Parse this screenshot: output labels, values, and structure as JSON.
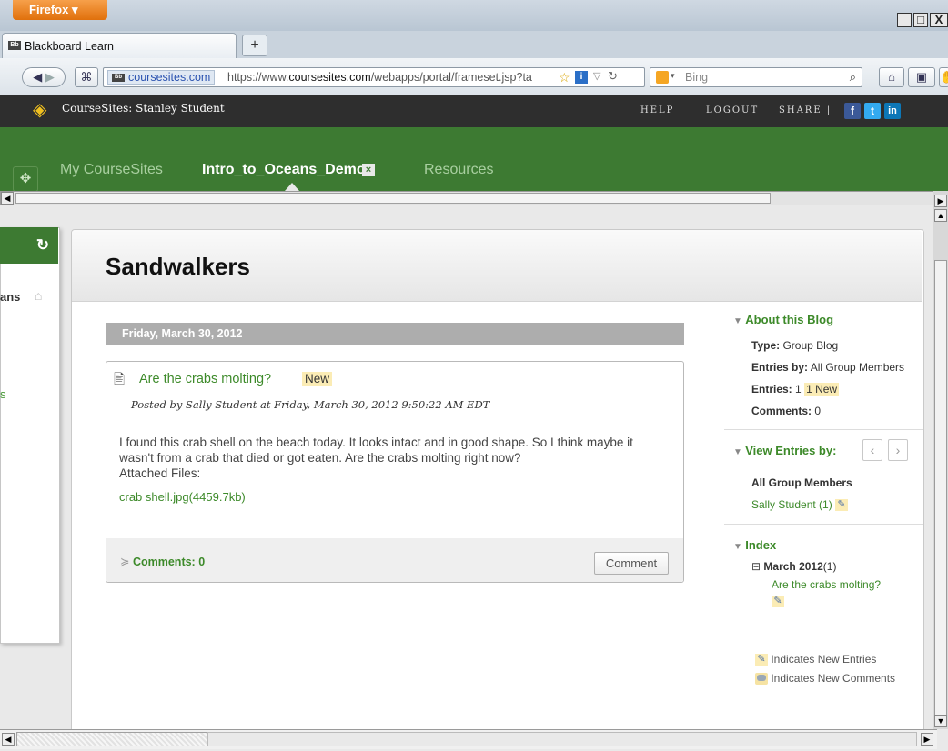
{
  "browser": {
    "menu_label": "Firefox",
    "tab_title": "Blackboard Learn",
    "new_tab": "+",
    "site_badge": "coursesites.com",
    "url_prefix": "https://www.",
    "url_domain": "coursesites.com",
    "url_path": "/webapps/portal/frameset.jsp?ta",
    "search_placeholder": "Bing",
    "win_min": "_",
    "win_max": "□",
    "win_close": "X"
  },
  "coursesites": {
    "title": "CourseSites: Stanley Student",
    "help": "HELP",
    "logout": "LOGOUT",
    "share": "SHARE |",
    "social": [
      "f",
      "t",
      "in"
    ]
  },
  "nav": {
    "my_coursesites": "My CourseSites",
    "current_course": "Intro_to_Oceans_Demo",
    "resources": "Resources",
    "close_tab": "×"
  },
  "left_panel": {
    "partial_title": "ans",
    "partial_link": "s",
    "refresh": "↻"
  },
  "blog": {
    "title": "Sandwalkers",
    "date_heading": "Friday, March 30, 2012",
    "entry": {
      "title": "Are the crabs molting?",
      "badge": "New",
      "posted": "Posted by Sally Student at Friday, March 30, 2012 9:50:22 AM EDT",
      "body": "I found this crab shell on the beach today. It looks intact and in good shape. So I think maybe it wasn't from a crab that died or got eaten. Are the crabs molting right now?",
      "attached_label": "Attached Files:",
      "attachment": "crab shell.jpg(4459.7kb)",
      "comments_toggle": "Comments: 0",
      "comment_button": "Comment"
    }
  },
  "sidebar": {
    "about": {
      "heading": "About this Blog",
      "type_label": "Type:",
      "type_value": "Group Blog",
      "entries_by_label": "Entries by:",
      "entries_by_value": "All Group Members",
      "entries_label": "Entries:",
      "entries_value": "1",
      "entries_new": "1 New",
      "comments_label": "Comments:",
      "comments_value": "0"
    },
    "view": {
      "heading": "View Entries by:",
      "prev": "‹",
      "next": "›",
      "all": "All Group Members",
      "member": "Sally Student (1)"
    },
    "index": {
      "heading": "Index",
      "month": "March 2012",
      "month_count": "(1)",
      "entry_link": "Are the crabs molting?"
    },
    "legend": {
      "new_entries": "Indicates New Entries",
      "new_comments": "Indicates New Comments"
    }
  },
  "colors": {
    "green_nav": "#3d7a32",
    "link_green": "#3d8a2a",
    "new_highlight": "#fbecb5",
    "firefox_orange": "#e0700c"
  }
}
